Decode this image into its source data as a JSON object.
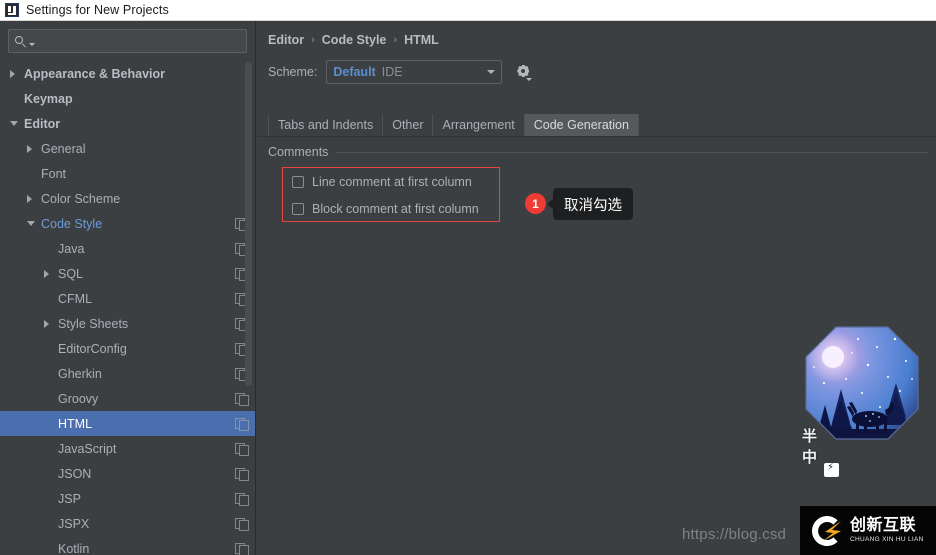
{
  "window": {
    "title": "Settings for New Projects",
    "app_icon": "intellij-idea-icon"
  },
  "sidebar": {
    "search": {
      "placeholder": "",
      "value": "",
      "icon": "search-icon"
    },
    "items": [
      {
        "label": "Appearance & Behavior",
        "indent": 0,
        "twisty": "collapsed",
        "bold": true,
        "copy": false,
        "selected": false,
        "linked": false
      },
      {
        "label": "Keymap",
        "indent": 0,
        "twisty": "none",
        "bold": true,
        "copy": false,
        "selected": false,
        "linked": false
      },
      {
        "label": "Editor",
        "indent": 0,
        "twisty": "expanded",
        "bold": true,
        "copy": false,
        "selected": false,
        "linked": false
      },
      {
        "label": "General",
        "indent": 1,
        "twisty": "collapsed",
        "bold": false,
        "copy": false,
        "selected": false,
        "linked": false
      },
      {
        "label": "Font",
        "indent": 1,
        "twisty": "none",
        "bold": false,
        "copy": false,
        "selected": false,
        "linked": false
      },
      {
        "label": "Color Scheme",
        "indent": 1,
        "twisty": "collapsed",
        "bold": false,
        "copy": false,
        "selected": false,
        "linked": false
      },
      {
        "label": "Code Style",
        "indent": 1,
        "twisty": "expanded",
        "bold": false,
        "copy": true,
        "selected": false,
        "linked": true
      },
      {
        "label": "Java",
        "indent": 2,
        "twisty": "none",
        "bold": false,
        "copy": true,
        "selected": false,
        "linked": false
      },
      {
        "label": "SQL",
        "indent": 2,
        "twisty": "collapsed",
        "bold": false,
        "copy": true,
        "selected": false,
        "linked": false
      },
      {
        "label": "CFML",
        "indent": 2,
        "twisty": "none",
        "bold": false,
        "copy": true,
        "selected": false,
        "linked": false
      },
      {
        "label": "Style Sheets",
        "indent": 2,
        "twisty": "collapsed",
        "bold": false,
        "copy": true,
        "selected": false,
        "linked": false
      },
      {
        "label": "EditorConfig",
        "indent": 2,
        "twisty": "none",
        "bold": false,
        "copy": true,
        "selected": false,
        "linked": false
      },
      {
        "label": "Gherkin",
        "indent": 2,
        "twisty": "none",
        "bold": false,
        "copy": true,
        "selected": false,
        "linked": false
      },
      {
        "label": "Groovy",
        "indent": 2,
        "twisty": "none",
        "bold": false,
        "copy": true,
        "selected": false,
        "linked": false
      },
      {
        "label": "HTML",
        "indent": 2,
        "twisty": "none",
        "bold": false,
        "copy": true,
        "selected": true,
        "linked": false
      },
      {
        "label": "JavaScript",
        "indent": 2,
        "twisty": "none",
        "bold": false,
        "copy": true,
        "selected": false,
        "linked": false
      },
      {
        "label": "JSON",
        "indent": 2,
        "twisty": "none",
        "bold": false,
        "copy": true,
        "selected": false,
        "linked": false
      },
      {
        "label": "JSP",
        "indent": 2,
        "twisty": "none",
        "bold": false,
        "copy": true,
        "selected": false,
        "linked": false
      },
      {
        "label": "JSPX",
        "indent": 2,
        "twisty": "none",
        "bold": false,
        "copy": true,
        "selected": false,
        "linked": false
      },
      {
        "label": "Kotlin",
        "indent": 2,
        "twisty": "none",
        "bold": false,
        "copy": true,
        "selected": false,
        "linked": false
      }
    ]
  },
  "main": {
    "breadcrumb": [
      "Editor",
      "Code Style",
      "HTML"
    ],
    "breadcrumb_separator": "›",
    "scheme": {
      "label": "Scheme:",
      "value": "Default",
      "scope": "IDE",
      "gear_icon": "gear-icon"
    },
    "tabs": [
      {
        "label": "Tabs and Indents",
        "active": false
      },
      {
        "label": "Other",
        "active": false
      },
      {
        "label": "Arrangement",
        "active": false
      },
      {
        "label": "Code Generation",
        "active": true
      }
    ],
    "group": {
      "title": "Comments"
    },
    "checkboxes": [
      {
        "label": "Line comment at first column",
        "checked": false
      },
      {
        "label": "Block comment at first column",
        "checked": false
      }
    ],
    "annotation": {
      "badge": "1",
      "tooltip": "取消勾选"
    }
  },
  "decoration": {
    "art_chars": [
      "半",
      "中"
    ],
    "watermark": "https://blog.csd",
    "logo": {
      "cn": "创新互联",
      "en": "CHUANG XIN HU LIAN"
    }
  },
  "colors": {
    "accent_selection": "#4b6eaf",
    "link": "#6b9bd8",
    "alert_red": "#ee3b33",
    "panel_bg": "#3c3f41",
    "titlebar_bg": "#ffffff"
  }
}
